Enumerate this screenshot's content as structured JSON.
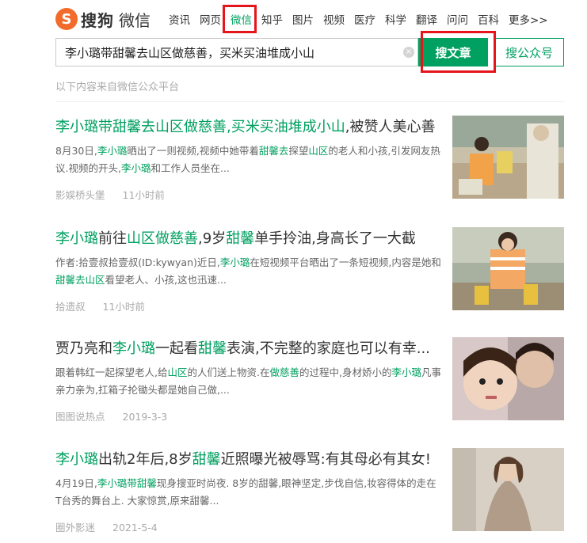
{
  "header": {
    "logo_mark": "S",
    "logo_name": "搜狗",
    "logo_product": "微信",
    "nav": [
      {
        "label": "资讯"
      },
      {
        "label": "网页"
      },
      {
        "label": "微信",
        "active": true
      },
      {
        "label": "知乎"
      },
      {
        "label": "图片"
      },
      {
        "label": "视频"
      },
      {
        "label": "医疗"
      },
      {
        "label": "科学"
      },
      {
        "label": "翻译"
      },
      {
        "label": "问问"
      },
      {
        "label": "百科"
      },
      {
        "label": "更多>>"
      }
    ]
  },
  "search": {
    "query": "李小璐带甜馨去山区做慈善，买米买油堆成小山",
    "clear_glyph": "×",
    "btn_article": "搜文章",
    "btn_account": "搜公众号"
  },
  "source_note": "以下内容来自微信公众平台",
  "results": [
    {
      "title": [
        {
          "t": "李小璐带甜馨去山区做慈善,买米买油堆成小山",
          "kw": true
        },
        {
          "t": ",被赞人美心善",
          "kw": false
        }
      ],
      "snippet": [
        {
          "t": "8月30日,",
          "kw": false
        },
        {
          "t": "李小璐",
          "kw": true
        },
        {
          "t": "晒出了一则视频,视频中她带着",
          "kw": false
        },
        {
          "t": "甜馨去",
          "kw": true
        },
        {
          "t": "探望",
          "kw": false
        },
        {
          "t": "山区",
          "kw": true
        },
        {
          "t": "的老人和小孩,引发网友热议.视频的开头,",
          "kw": false
        },
        {
          "t": "李小璐",
          "kw": true
        },
        {
          "t": "和工作人员坐在...",
          "kw": false
        }
      ],
      "source": "影娱桥头堡",
      "time": "11小时前"
    },
    {
      "title": [
        {
          "t": "李小璐",
          "kw": true
        },
        {
          "t": "前往",
          "kw": false
        },
        {
          "t": "山区做慈善",
          "kw": true
        },
        {
          "t": ",9岁",
          "kw": false
        },
        {
          "t": "甜馨",
          "kw": true
        },
        {
          "t": "单手拎油,身高长了一大截",
          "kw": false
        }
      ],
      "snippet": [
        {
          "t": "作者:拾壹叔拾壹叔(ID:kywyan)近日,",
          "kw": false
        },
        {
          "t": "李小璐",
          "kw": true
        },
        {
          "t": "在短视频平台晒出了一条短视频,内容是她和",
          "kw": false
        },
        {
          "t": "甜馨去山区",
          "kw": true
        },
        {
          "t": "看望老人、小孩,这也迅速...",
          "kw": false
        }
      ],
      "source": "拾遗叔",
      "time": "11小时前"
    },
    {
      "title": [
        {
          "t": "贾乃亮和",
          "kw": false
        },
        {
          "t": "李小璐",
          "kw": true
        },
        {
          "t": "一起看",
          "kw": false
        },
        {
          "t": "甜馨",
          "kw": true
        },
        {
          "t": "表演,不完整的家庭也可以有幸...",
          "kw": false
        }
      ],
      "snippet": [
        {
          "t": "跟着韩红一起探望老人,给",
          "kw": false
        },
        {
          "t": "山区",
          "kw": true
        },
        {
          "t": "的人们送上物资.在",
          "kw": false
        },
        {
          "t": "做慈善",
          "kw": true
        },
        {
          "t": "的过程中,身材娇小的",
          "kw": false
        },
        {
          "t": "李小璐",
          "kw": true
        },
        {
          "t": "凡事亲力亲为,扛箱子抡锄头都是她自己做,...",
          "kw": false
        }
      ],
      "source": "图图说热点",
      "time": "2019-3-3"
    },
    {
      "title": [
        {
          "t": "李小璐",
          "kw": true
        },
        {
          "t": "出轨2年后,8岁",
          "kw": false
        },
        {
          "t": "甜馨",
          "kw": true
        },
        {
          "t": "近照曝光被辱骂:有其母必有其女!",
          "kw": false
        }
      ],
      "snippet": [
        {
          "t": "4月19日,",
          "kw": false
        },
        {
          "t": "李小璐带甜馨",
          "kw": true
        },
        {
          "t": "现身搜亚时尚夜. 8岁的甜馨,眼神坚定,步伐自信,妆容得体的走在T台秀的舞台上. 大家惊赏,原来甜馨...",
          "kw": false
        }
      ],
      "source": "圈外影迷",
      "time": "2021-5-4"
    }
  ],
  "colors": {
    "brand_green": "#00a060",
    "logo_orange": "#f26b2a",
    "highlight_red": "#e5151b"
  }
}
